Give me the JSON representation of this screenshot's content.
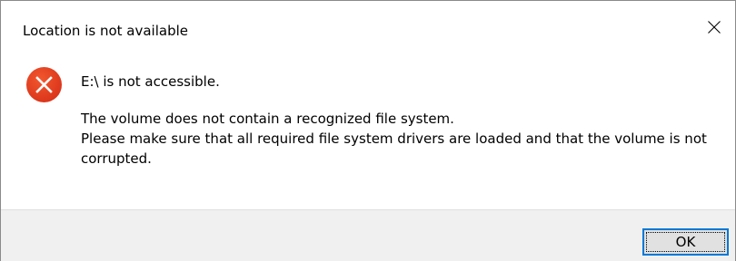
{
  "dialog": {
    "title": "Location is not available",
    "close_icon": "close-icon",
    "icon": "error-icon",
    "colors": {
      "error_red": "#e81123",
      "button_focus_border": "#0078d7",
      "footer_bg": "#f0f0f0"
    }
  },
  "message": {
    "line1": "E:\\ is not accessible.",
    "line2": "The volume does not contain a recognized file system.",
    "line3": "Please make sure that all required file system drivers are loaded and that the volume is not",
    "line4": "corrupted."
  },
  "footer": {
    "ok_label": "OK"
  }
}
